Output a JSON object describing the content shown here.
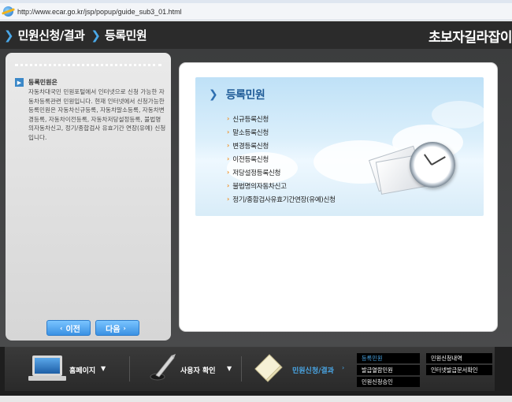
{
  "browser": {
    "url": "http://www.ecar.go.kr/jsp/popup/guide_sub3_01.html"
  },
  "header": {
    "breadcrumb_1": "민원신청/결과",
    "breadcrumb_2": "등록민원",
    "brand": "초보자길라잡이"
  },
  "sidebar": {
    "title": "등록민원은",
    "description": "자동차대국민 민원포털에서 인터넷으로 신청 가능한 자동차등록관련 민원입니다. 현재 인터넷에서 신청가능한 등록민원은 자동차신규등록, 자동차말소등록, 자동차변경등록, 자동차이전등록, 자동차저당설정등록, 불법명의자동차신고, 정기/종합검사 유효기간 연장(유예) 신청입니다.",
    "prev_label": "이전",
    "next_label": "다음"
  },
  "content": {
    "title": "등록민원",
    "links": [
      "신규등록신청",
      "말소등록신청",
      "변경등록신청",
      "이전등록신청",
      "저당설정등록신청",
      "불법명의자동차신고",
      "정기/종합검사유효기간연장(유예)신청"
    ]
  },
  "bottom_nav": {
    "home": "홈페이지",
    "user_check": "사용자 확인",
    "apply_result": "민원신청/결과",
    "quick_links": {
      "registration": "등록민원",
      "issuance": "발급열람민원",
      "approval": "민원신청승인",
      "history": "민원신청내역",
      "internet_issue": "인터넷발급문서확인"
    }
  },
  "colors": {
    "accent": "#4aa8e8",
    "header_bg": "#2b2b2b",
    "button_blue": "#3a91e3",
    "link_arrow": "#f28c1c"
  }
}
